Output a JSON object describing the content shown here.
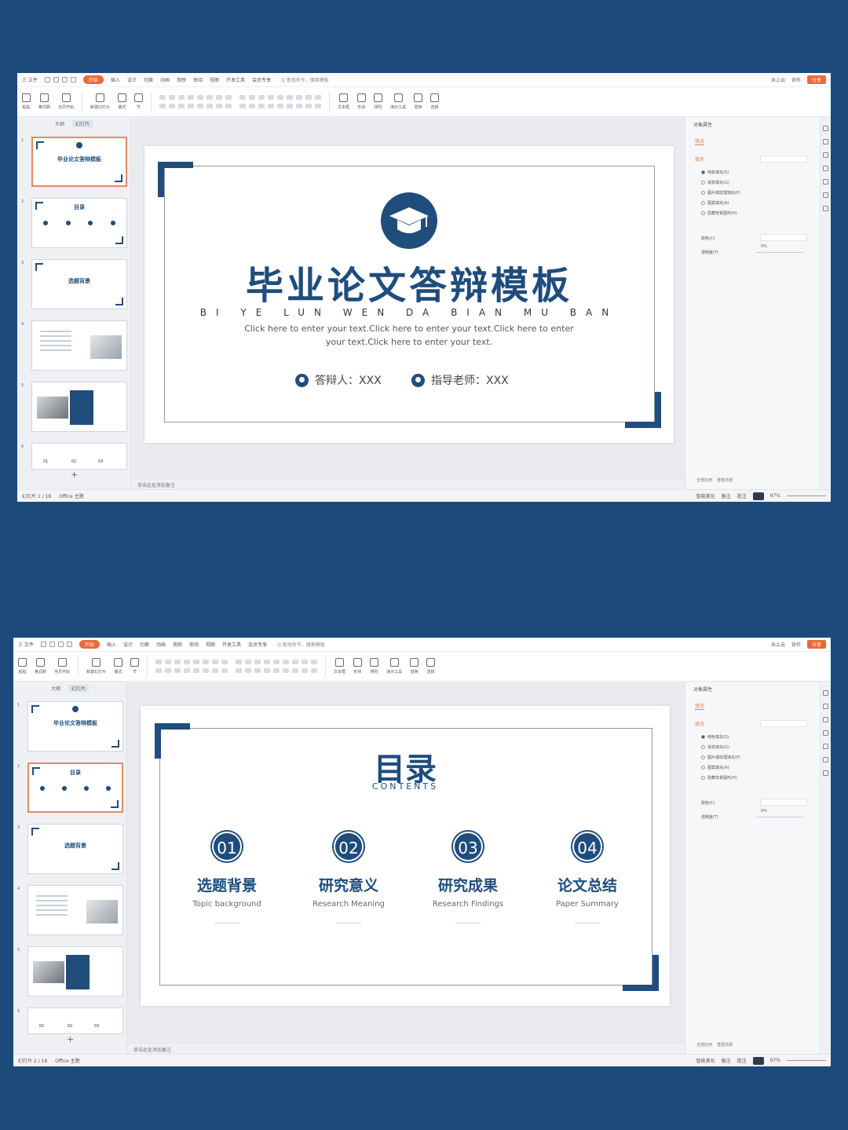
{
  "colors": {
    "background": "#1c4a7a",
    "accent": "#1f4d7c",
    "orange": "#ea6a3a"
  },
  "menu": {
    "items": [
      "三 文件",
      "开始",
      "插入",
      "设计",
      "切换",
      "动画",
      "放映",
      "审阅",
      "视图",
      "开发工具",
      "会员专享"
    ],
    "search": "Q 查找命令、搜索模板",
    "right": [
      "未上云",
      "协作"
    ],
    "share": "分享"
  },
  "toolbar": {
    "groups": [
      "粘贴",
      "格式刷",
      "当页开始",
      "新建幻灯片",
      "版式",
      "节",
      "文本框",
      "形状",
      "排列",
      "演示工具",
      "替换",
      "选择"
    ]
  },
  "thumbs": {
    "tabs": [
      "大纲",
      "幻灯片"
    ],
    "slide1_title": "毕业论文答辩模板",
    "slide2_title": "目录",
    "slide3_title": "选题背景",
    "numbers": [
      "1",
      "2",
      "3",
      "4",
      "5",
      "6"
    ],
    "s6": [
      "01",
      "02",
      "03"
    ]
  },
  "notes_placeholder": "单击此处添加备注",
  "side": {
    "title": "对象属性",
    "tab": "填充",
    "head": "填充",
    "options": [
      "纯色填充(S)",
      "渐变填充(G)",
      "图片或纹理填充(P)",
      "图案填充(A)",
      "隐藏背景图形(H)"
    ],
    "color_label": "颜色(C)",
    "transparency_label": "透明度(T)",
    "transparency_value": "0%",
    "bottom": [
      "全部应用",
      "重置背景"
    ]
  },
  "window1": {
    "status": {
      "slide": "幻灯片 1 / 18",
      "theme": "Office 主题",
      "beautify": "智能美化",
      "notes": "备注",
      "comment": "批注",
      "zoom": "97%"
    },
    "slide": {
      "title": "毕业论文答辩模板",
      "pinyin": "BI YE LUN WEN DA BIAN MU BAN",
      "body1": "Click here to enter your text.Click here to enter your text.Click here to enter",
      "body2": "your text.Click here to enter your text.",
      "p1_label": "答辩人：XXX",
      "p2_label": "指导老师：XXX"
    }
  },
  "window2": {
    "status": {
      "slide": "幻灯片 2 / 18",
      "theme": "Office 主题",
      "beautify": "智能美化",
      "notes": "备注",
      "comment": "批注",
      "zoom": "97%"
    },
    "slide": {
      "title": "目录",
      "subtitle": "CONTENTS",
      "items": [
        {
          "num": "01",
          "cn": "选题背景",
          "en": "Topic background"
        },
        {
          "num": "02",
          "cn": "研究意义",
          "en": "Research Meaning"
        },
        {
          "num": "03",
          "cn": "研究成果",
          "en": "Research Findings"
        },
        {
          "num": "04",
          "cn": "论文总结",
          "en": "Paper Summary"
        }
      ]
    }
  }
}
